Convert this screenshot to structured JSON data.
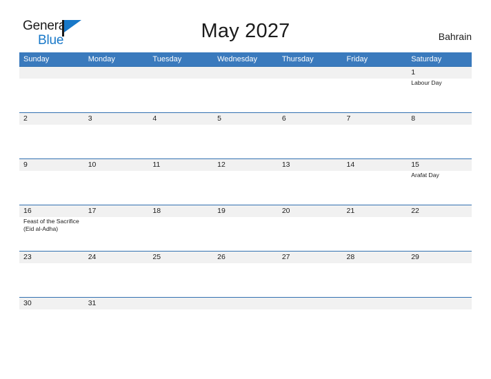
{
  "brand": {
    "word_one": "General",
    "word_two": "Blue",
    "flag_icon": "flag-icon",
    "accent_color": "#1878c8"
  },
  "header": {
    "title": "May 2027",
    "region": "Bahrain"
  },
  "theme": {
    "header_blue": "#3a7abd",
    "row_border_blue": "#2f6fb0",
    "number_band_gray": "#f1f1f1",
    "text_dark": "#1b1b1b"
  },
  "calendar": {
    "day_headers": [
      "Sunday",
      "Monday",
      "Tuesday",
      "Wednesday",
      "Thursday",
      "Friday",
      "Saturday"
    ],
    "weeks": [
      {
        "days": [
          {
            "num": "",
            "event": ""
          },
          {
            "num": "",
            "event": ""
          },
          {
            "num": "",
            "event": ""
          },
          {
            "num": "",
            "event": ""
          },
          {
            "num": "",
            "event": ""
          },
          {
            "num": "",
            "event": ""
          },
          {
            "num": "1",
            "event": "Labour Day"
          }
        ]
      },
      {
        "days": [
          {
            "num": "2",
            "event": ""
          },
          {
            "num": "3",
            "event": ""
          },
          {
            "num": "4",
            "event": ""
          },
          {
            "num": "5",
            "event": ""
          },
          {
            "num": "6",
            "event": ""
          },
          {
            "num": "7",
            "event": ""
          },
          {
            "num": "8",
            "event": ""
          }
        ]
      },
      {
        "days": [
          {
            "num": "9",
            "event": ""
          },
          {
            "num": "10",
            "event": ""
          },
          {
            "num": "11",
            "event": ""
          },
          {
            "num": "12",
            "event": ""
          },
          {
            "num": "13",
            "event": ""
          },
          {
            "num": "14",
            "event": ""
          },
          {
            "num": "15",
            "event": "Arafat Day"
          }
        ]
      },
      {
        "days": [
          {
            "num": "16",
            "event": "Feast of the Sacrifice (Eid al-Adha)"
          },
          {
            "num": "17",
            "event": ""
          },
          {
            "num": "18",
            "event": ""
          },
          {
            "num": "19",
            "event": ""
          },
          {
            "num": "20",
            "event": ""
          },
          {
            "num": "21",
            "event": ""
          },
          {
            "num": "22",
            "event": ""
          }
        ]
      },
      {
        "days": [
          {
            "num": "23",
            "event": ""
          },
          {
            "num": "24",
            "event": ""
          },
          {
            "num": "25",
            "event": ""
          },
          {
            "num": "26",
            "event": ""
          },
          {
            "num": "27",
            "event": ""
          },
          {
            "num": "28",
            "event": ""
          },
          {
            "num": "29",
            "event": ""
          }
        ]
      },
      {
        "days": [
          {
            "num": "30",
            "event": ""
          },
          {
            "num": "31",
            "event": ""
          },
          {
            "num": "",
            "event": ""
          },
          {
            "num": "",
            "event": ""
          },
          {
            "num": "",
            "event": ""
          },
          {
            "num": "",
            "event": ""
          },
          {
            "num": "",
            "event": ""
          }
        ]
      }
    ]
  }
}
